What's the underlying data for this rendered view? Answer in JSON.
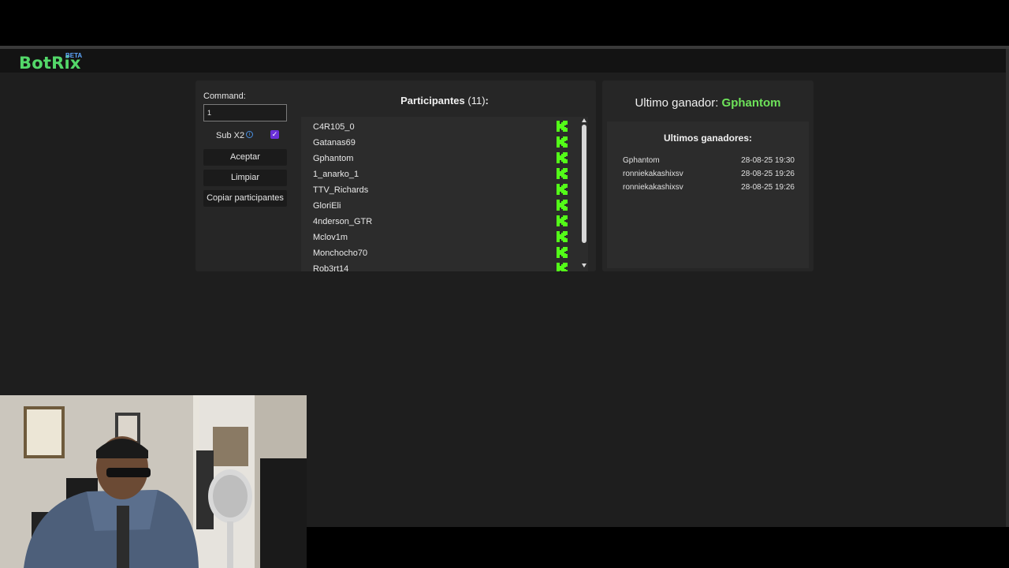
{
  "brand": {
    "name": "BotRix",
    "badge": "BETA"
  },
  "controls": {
    "command_label": "Command:",
    "command_value": "1",
    "sub_label": "Sub X2",
    "sub_checked": true,
    "accept_label": "Aceptar",
    "clear_label": "Limpiar",
    "copy_label": "Copiar participantes"
  },
  "participants": {
    "title": "Participantes",
    "count": "(11)",
    "suffix": ":",
    "items": [
      {
        "name": "C4R105_0",
        "platform": "kick-icon"
      },
      {
        "name": "Gatanas69",
        "platform": "kick-icon"
      },
      {
        "name": "Gphantom",
        "platform": "kick-icon"
      },
      {
        "name": "1_anarko_1",
        "platform": "kick-icon"
      },
      {
        "name": "TTV_Richards",
        "platform": "kick-icon"
      },
      {
        "name": "GloriEli",
        "platform": "kick-icon"
      },
      {
        "name": "4nderson_GTR",
        "platform": "kick-icon"
      },
      {
        "name": "Mclov1m",
        "platform": "kick-icon"
      },
      {
        "name": "Monchocho70",
        "platform": "kick-icon"
      },
      {
        "name": "Rob3rt14",
        "platform": "kick-icon"
      }
    ]
  },
  "winner": {
    "label": "Ultimo ganador: ",
    "name": "Gphantom",
    "history_title": "Ultimos ganadores:",
    "history": [
      {
        "name": "Gphantom",
        "date": "28-08-25 19:30"
      },
      {
        "name": "ronniekakashixsv",
        "date": "28-08-25 19:26"
      },
      {
        "name": "ronniekakashixsv",
        "date": "28-08-25 19:26"
      }
    ]
  },
  "colors": {
    "brand_green": "#53d769",
    "kick_green": "#53fc18",
    "winner_green": "#6ee35a",
    "checkbox_purple": "#6a2fd8"
  }
}
